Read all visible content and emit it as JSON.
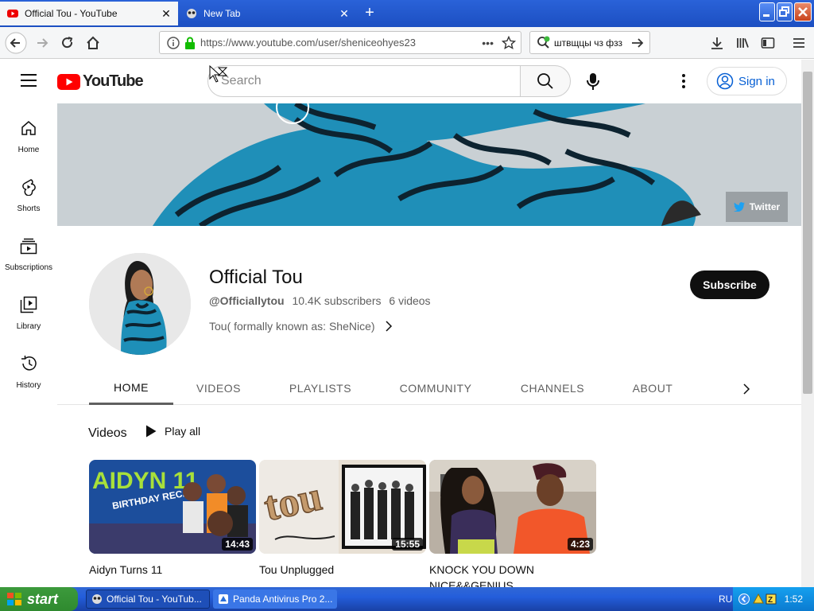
{
  "browser": {
    "tabs": [
      {
        "title": "Official Tou - YouTube"
      },
      {
        "title": "New Tab"
      }
    ],
    "url": "https://www.youtube.com/user/sheniceohyes23",
    "search_text": "штвщцы чз фзз",
    "url_menu": "•••"
  },
  "youtube": {
    "logo_text": "YouTube",
    "search_placeholder": "Search",
    "sign_in": "Sign in",
    "sidebar": [
      {
        "label": "Home"
      },
      {
        "label": "Shorts"
      },
      {
        "label": "Subscriptions"
      },
      {
        "label": "Library"
      },
      {
        "label": "History"
      }
    ],
    "twitter": "Twitter",
    "channel": {
      "name": "Official Tou",
      "handle": "@Officiallytou",
      "subscribers": "10.4K subscribers",
      "videos": "6 videos",
      "description": "Tou( formally known as: SheNice)"
    },
    "subscribe": "Subscribe",
    "tabs": [
      "HOME",
      "VIDEOS",
      "PLAYLISTS",
      "COMMUNITY",
      "CHANNELS",
      "ABOUT"
    ],
    "section_title": "Videos",
    "play_all": "Play all",
    "videos": [
      {
        "title": "Aidyn Turns 11",
        "duration": "14:43",
        "thumb_text": "AIDYN 11",
        "thumb_sub": "BIRTHDAY RECAP"
      },
      {
        "title": "Tou Unplugged",
        "duration": "15:55",
        "thumb_text": "tou"
      },
      {
        "title": "KNOCK YOU DOWN NICE&&GENIUS",
        "duration": "4:23"
      }
    ]
  },
  "taskbar": {
    "start": "start",
    "tasks": [
      {
        "label": "Official Tou - YouTub..."
      },
      {
        "label": "Panda Antivirus Pro 2..."
      }
    ],
    "lang": "RU",
    "clock": "1:52"
  }
}
